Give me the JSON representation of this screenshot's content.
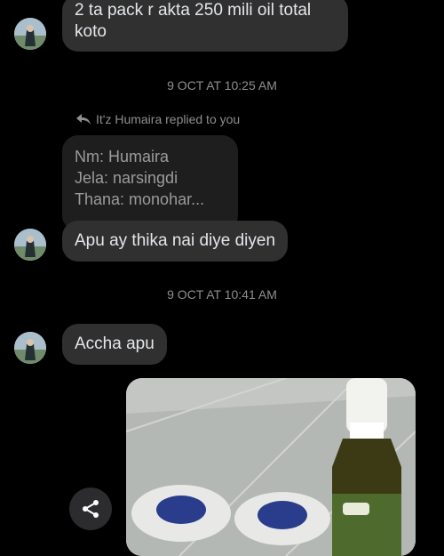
{
  "messages": {
    "m1": "2 ta pack r akta 250 mili oil total koto",
    "ts1": "9 OCT AT 10:25 AM",
    "reply_header": "It'z Humaira replied to you",
    "quoted": [
      "Nm: Humaira",
      "Jela: narsingdi",
      "Thana: monohar..."
    ],
    "m2": "Apu ay thika nai diye diyen",
    "ts2": "9 OCT AT 10:41 AM",
    "m3": "Accha apu"
  },
  "icons": {
    "reply": "reply-arrow-icon",
    "share": "share-icon"
  },
  "colors": {
    "background": "#000000",
    "bubble": "#303030",
    "quoted_bubble": "#1e1e1e",
    "timestamp": "#8e8f93"
  }
}
